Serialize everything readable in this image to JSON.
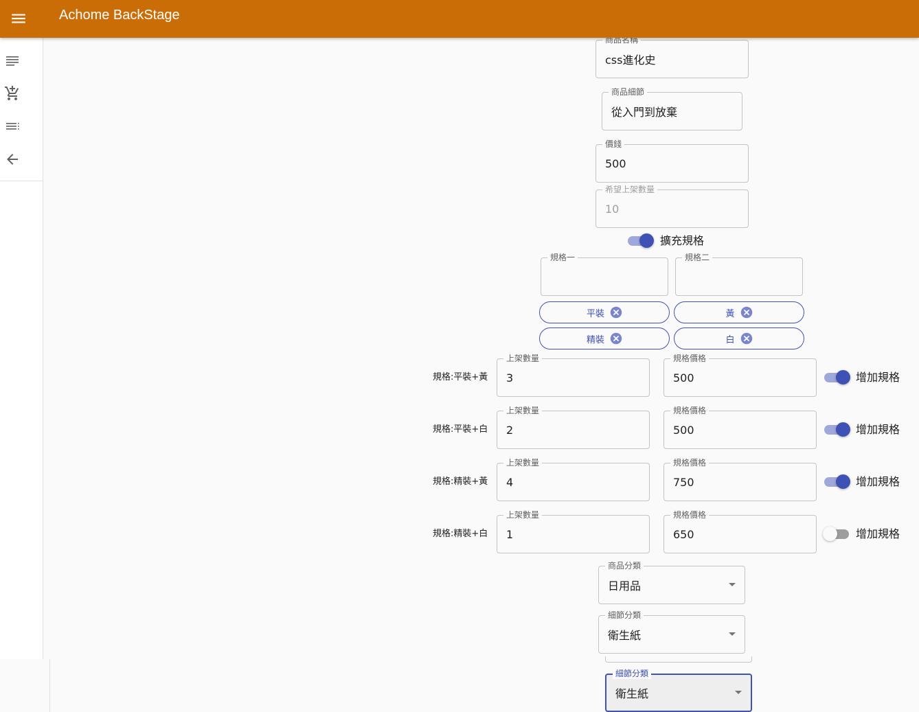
{
  "app": {
    "title": "Achome BackStage"
  },
  "icons": {
    "menu": "menu-icon",
    "drawer": [
      "list-icon",
      "add-shopping-cart-icon",
      "playlist-icon",
      "arrow-back-icon"
    ],
    "chip_delete": "cancel-circle-icon",
    "select_arrow": "arrow-drop-down-icon"
  },
  "colors": {
    "appbar": "#cb6d06",
    "primary": "#3f51b5",
    "primary_light": "#9fa8da"
  },
  "product": {
    "name": {
      "label": "商品名稱",
      "value": "css進化史"
    },
    "detail": {
      "label": "商品細節",
      "value": "從入門到放棄"
    },
    "price": {
      "label": "價錢",
      "value": "500"
    },
    "quantity": {
      "label": "希望上架數量",
      "value": "10"
    }
  },
  "spec_toggle": {
    "label": "擴充規格",
    "on": true
  },
  "spec_inputs": {
    "spec1": {
      "label": "規格一",
      "value": ""
    },
    "spec2": {
      "label": "規格二",
      "value": ""
    }
  },
  "chips": {
    "spec1": [
      "平裝",
      "精裝"
    ],
    "spec2": [
      "黃",
      "白"
    ]
  },
  "variants": [
    {
      "name": "規格:平裝+黃",
      "qty_label": "上架數量",
      "qty": "3",
      "price_label": "規格價格",
      "price": "500",
      "toggle_label": "增加規格",
      "enabled": true
    },
    {
      "name": "規格:平裝+白",
      "qty_label": "上架數量",
      "qty": "2",
      "price_label": "規格價格",
      "price": "500",
      "toggle_label": "增加規格",
      "enabled": true
    },
    {
      "name": "規格:精裝+黃",
      "qty_label": "上架數量",
      "qty": "4",
      "price_label": "規格價格",
      "price": "750",
      "toggle_label": "增加規格",
      "enabled": true
    },
    {
      "name": "規格:精裝+白",
      "qty_label": "上架數量",
      "qty": "1",
      "price_label": "規格價格",
      "price": "650",
      "toggle_label": "增加規格",
      "enabled": false
    }
  ],
  "category": {
    "label": "商品分類",
    "value": "日用品"
  },
  "subcategory": {
    "label": "細節分類",
    "value": "衛生紙"
  },
  "subcategory_focused": {
    "label": "細節分類",
    "value": "衛生紙"
  }
}
